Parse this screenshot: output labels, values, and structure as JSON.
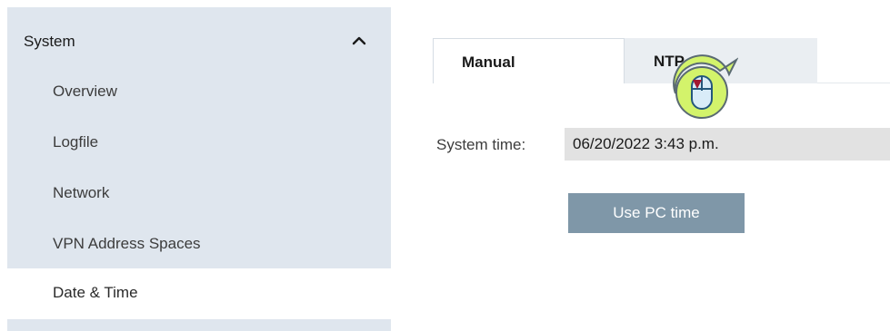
{
  "sidebar": {
    "section_title": "System",
    "items": [
      {
        "label": "Overview",
        "active": false
      },
      {
        "label": "Logfile",
        "active": false
      },
      {
        "label": "Network",
        "active": false
      },
      {
        "label": "VPN Address Spaces",
        "active": false
      },
      {
        "label": "Date & Time",
        "active": true
      }
    ]
  },
  "tabs": {
    "manual_label": "Manual",
    "ntp_label": "NTP",
    "selected": "Manual"
  },
  "form": {
    "system_time_label": "System time:",
    "system_time_value": "06/20/2022 3:43 p.m.",
    "use_pc_time_label": "Use PC time"
  },
  "icons": {
    "section_toggle": "chevron-up-icon",
    "pointer_hint": "mouse-click-icon"
  },
  "colors": {
    "sidebar_bg": "#dfe6ee",
    "button_bg": "#7f97a8",
    "field_bg": "#e2e2e2",
    "mouse_callout": "#d3f36b",
    "click_marker": "#a31830"
  }
}
